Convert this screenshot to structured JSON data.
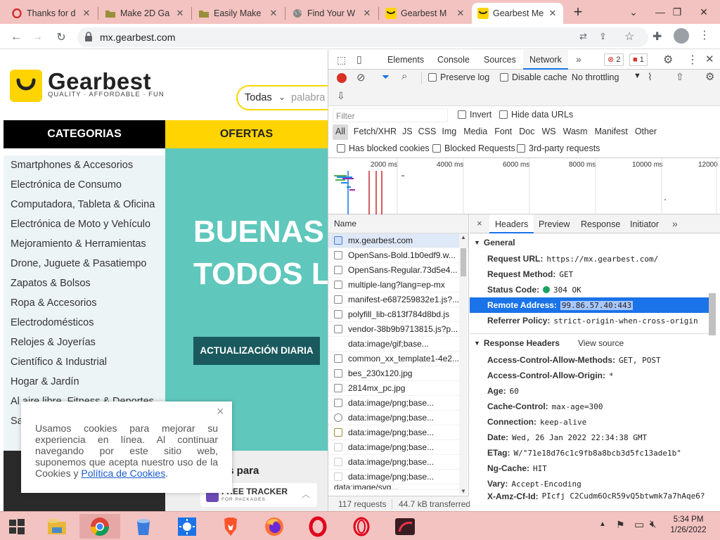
{
  "browser": {
    "tabs": [
      {
        "title": "Thanks for d",
        "icon": "opera-icon",
        "color": "#d32f2f"
      },
      {
        "title": "Make 2D Ga",
        "icon": "folder-icon",
        "color": "#9a8f3a"
      },
      {
        "title": "Easily Make",
        "icon": "folder-icon",
        "color": "#9a8f3a"
      },
      {
        "title": "Find Your W",
        "icon": "globe-icon",
        "color": "#777777"
      },
      {
        "title": "Gearbest M",
        "icon": "gearbest-icon",
        "color": "#ffd400"
      },
      {
        "title": "Gearbest Me",
        "icon": "gearbest-icon",
        "color": "#ffd400"
      }
    ],
    "new_tab": "+",
    "url": "mx.gearbest.com"
  },
  "site": {
    "logo_text": "Gearbest",
    "logo_tagline": "QUALITY · AFFORDABLE · FUN",
    "search_select": "Todas",
    "search_placeholder": "palabra",
    "nav_categories": "CATEGORIAS",
    "nav_offers": "OFERTAS",
    "categories": [
      "Smartphones & Accesorios",
      "Electrónica de Consumo",
      "Computadora, Tableta & Oficina",
      "Electrónica de Moto y Vehículo",
      "Mejoramiento & Herramientas",
      "Drone, Juguete & Pasatiempo",
      "Zapatos & Bolsos",
      "Ropa & Accesorios",
      "Electrodomésticos",
      "Relojes & Joyerías",
      "Científico & Industrial",
      "Hogar & Jardín",
      "Al aire libre, Fitness & Deportes",
      "Sa"
    ],
    "banner_line1": "BUENAS",
    "banner_line2": "TODOS L",
    "banner_button": "ACTUALIZACIÓN DIARIA",
    "dark_strip_text": "os para",
    "tracker_title": "FREE TRACKER",
    "tracker_sub": "FOR PACKAGES",
    "cookie_text": "Usamos cookies para mejorar su experiencia en línea. Al continuar navegando por este sitio web, suponemos que acepta nuestro uso de la Cookies y",
    "cookie_link": "Política de Cookies",
    "cookie_end": ".",
    "cookie_close": "×"
  },
  "devtools": {
    "tabs": [
      "Elements",
      "Console",
      "Sources",
      "Network"
    ],
    "active_tab": "Network",
    "more_tabs": "»",
    "errors": "2",
    "warnings": "1",
    "preserve_log": "Preserve log",
    "disable_cache": "Disable cache",
    "throttling": "No throttling",
    "filter_placeholder": "Filter",
    "invert": "Invert",
    "hide_data_urls": "Hide data URLs",
    "type_filters": [
      "All",
      "Fetch/XHR",
      "JS",
      "CSS",
      "Img",
      "Media",
      "Font",
      "Doc",
      "WS",
      "Wasm",
      "Manifest",
      "Other"
    ],
    "has_blocked_cookies": "Has blocked cookies",
    "blocked_requests": "Blocked Requests",
    "third_party": "3rd-party requests",
    "timeline_ticks": [
      "2000 ms",
      "4000 ms",
      "6000 ms",
      "8000 ms",
      "10000 ms",
      "12000"
    ],
    "name_header": "Name",
    "requests": [
      "mx.gearbest.com",
      "OpenSans-Bold.1b0edf9.w...",
      "OpenSans-Regular.73d5e4...",
      "multiple-lang?lang=ep-mx",
      "manifest-e687259832e1.js?...",
      "polyfill_lib-c813f784d8bd.js",
      "vendor-38b9b9713815.js?p...",
      "data:image/gif;base...",
      "common_xx_template1-4e2...",
      "bes_230x120.jpg",
      "2814mx_pc.jpg",
      "data:image/png;base...",
      "data:image/png;base...",
      "data:image/png;base...",
      "data:image/png;base...",
      "data:image/png;base...",
      "data:image/png;base...",
      "data:image/svg..."
    ],
    "status_requests": "117 requests",
    "status_transferred": "44.7 kB transferred",
    "detail_tabs": [
      "Headers",
      "Preview",
      "Response",
      "Initiator"
    ],
    "detail_close": "×",
    "detail_more": "»",
    "general_title": "General",
    "general": [
      {
        "k": "Request URL:",
        "v": "https://mx.gearbest.com/"
      },
      {
        "k": "Request Method:",
        "v": "GET"
      },
      {
        "k": "Status Code:",
        "v": "304 OK"
      },
      {
        "k": "Remote Address:",
        "v": "99.86.57.40:443"
      },
      {
        "k": "Referrer Policy:",
        "v": "strict-origin-when-cross-origin"
      }
    ],
    "response_title": "Response Headers",
    "view_source": "View source",
    "response": [
      {
        "k": "Access-Control-Allow-Methods:",
        "v": "GET, POST"
      },
      {
        "k": "Access-Control-Allow-Origin:",
        "v": "*"
      },
      {
        "k": "Age:",
        "v": "60"
      },
      {
        "k": "Cache-Control:",
        "v": "max-age=300"
      },
      {
        "k": "Connection:",
        "v": "keep-alive"
      },
      {
        "k": "Date:",
        "v": "Wed, 26 Jan 2022 22:34:38 GMT"
      },
      {
        "k": "ETag:",
        "v": "W/\"71e18d76c1c9fb8a8bcb3d5fc13ade1b\""
      },
      {
        "k": "Ng-Cache:",
        "v": "HIT"
      },
      {
        "k": "Vary:",
        "v": "Accept-Encoding"
      },
      {
        "k": "X-Amz-Cf-Id:",
        "v": "PIcfj_C2Cudm6OcR59vQ5btwmk7a7hAqe6?"
      }
    ]
  },
  "taskbar": {
    "time": "5:34 PM",
    "date": "1/26/2022"
  }
}
